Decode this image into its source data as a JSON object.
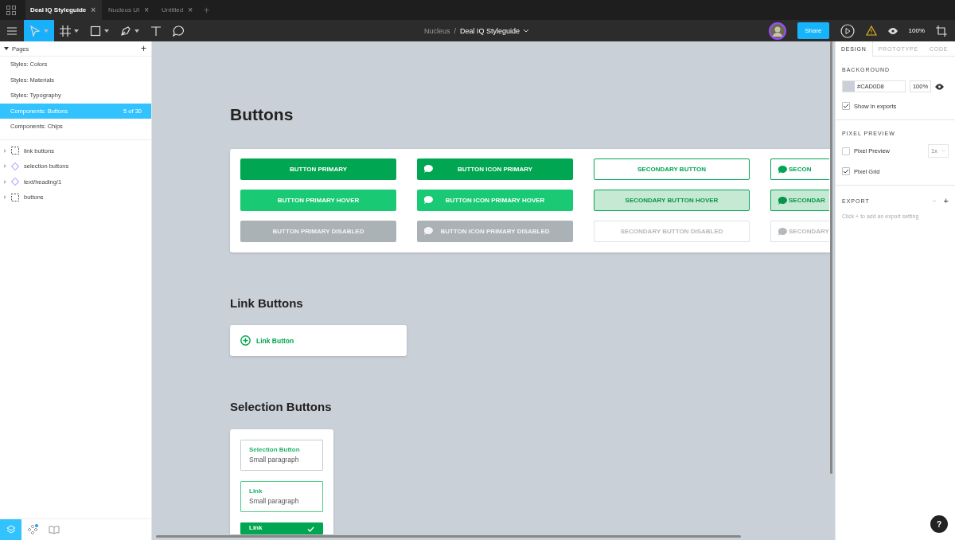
{
  "file_tabs": [
    {
      "label": "Deal IQ Styleguide",
      "selected": true,
      "close": "×"
    },
    {
      "label": "Nucleus UI",
      "selected": false,
      "close": "×"
    },
    {
      "label": "Untitled",
      "selected": false,
      "close": "×"
    }
  ],
  "new_tab": "+",
  "tools": [
    {
      "kind": "select",
      "selected": true,
      "dropdown": true
    },
    {
      "kind": "frame",
      "selected": false,
      "dropdown": true
    },
    {
      "kind": "shape",
      "selected": false,
      "dropdown": true
    },
    {
      "kind": "pen",
      "selected": false,
      "dropdown": true
    },
    {
      "kind": "text",
      "selected": false,
      "dropdown": false
    },
    {
      "kind": "comment",
      "selected": false,
      "dropdown": false
    }
  ],
  "breadcrumb": {
    "project": "Nucleus",
    "separator": "/",
    "file": "Deal IQ Styleguide"
  },
  "share": "Share",
  "zoom": "100%",
  "pages": {
    "title": "Pages",
    "add": "+",
    "expanded": true,
    "items": [
      {
        "label": "Styles: Colors",
        "selected": false
      },
      {
        "label": "Styles: Materials",
        "selected": false
      },
      {
        "label": "Styles: Typography",
        "selected": false
      },
      {
        "label": "Components: Buttons",
        "selected": true,
        "count": "5 of 30"
      },
      {
        "label": "Components: Chips",
        "selected": false
      }
    ]
  },
  "layers": [
    {
      "kind": "frame",
      "label": "link buttons"
    },
    {
      "kind": "component",
      "label": "selection buttons"
    },
    {
      "kind": "component",
      "label": "text/heading/1"
    },
    {
      "kind": "frame",
      "label": "buttons"
    }
  ],
  "bottom_tabs": [
    {
      "kind": "layers",
      "selected": true,
      "badge": false
    },
    {
      "kind": "components",
      "selected": false,
      "badge": true
    },
    {
      "kind": "library",
      "selected": false,
      "badge": false
    }
  ],
  "canvas": {
    "headings": [
      "Buttons",
      "Link Buttons",
      "Selection Buttons"
    ],
    "button_grid": [
      [
        {
          "label": "BUTTON PRIMARY",
          "kind": "primary",
          "icon": false
        },
        {
          "label": "BUTTON ICON PRIMARY",
          "kind": "primary",
          "icon": true
        },
        {
          "label": "SECONDARY BUTTON",
          "kind": "secondary",
          "icon": false
        },
        {
          "label": "SECON",
          "kind": "secondary",
          "icon": true
        }
      ],
      [
        {
          "label": "BUTTON PRIMARY HOVER",
          "kind": "primary",
          "hover": true,
          "icon": false
        },
        {
          "label": "BUTTON ICON PRIMARY HOVER",
          "kind": "primary",
          "hover": true,
          "icon": true
        },
        {
          "label": "SECONDARY BUTTON HOVER",
          "kind": "secondary",
          "hover": true,
          "icon": false
        },
        {
          "label": "SECONDAR",
          "kind": "secondary",
          "hover": true,
          "icon": true
        }
      ],
      [
        {
          "label": "BUTTON PRIMARY DISABLED",
          "kind": "primary",
          "disabled": true,
          "icon": false
        },
        {
          "label": "BUTTON ICON PRIMARY DISABLED",
          "kind": "primary",
          "disabled": true,
          "icon": true
        },
        {
          "label": "SECONDARY BUTTON DISABLED",
          "kind": "secondary",
          "disabled": true,
          "icon": false
        },
        {
          "label": "SECONDARY",
          "kind": "secondary",
          "disabled": true,
          "icon": true
        }
      ]
    ],
    "link_button": "Link Button",
    "selection_buttons": [
      {
        "title": "Selection Button",
        "text": "Small paragraph",
        "hover": false,
        "selected": false
      },
      {
        "title": "Link",
        "text": "Small paragraph",
        "hover": true,
        "selected": false
      },
      {
        "title": "Link",
        "hover": false,
        "selected": true
      }
    ]
  },
  "inspector": {
    "tabs": [
      {
        "label": "DESIGN",
        "selected": true
      },
      {
        "label": "PROTOTYPE",
        "selected": false
      },
      {
        "label": "CODE",
        "selected": false
      }
    ],
    "background": {
      "title": "BACKGROUND",
      "color": "#cad0d8",
      "hex": "#CAD0D8",
      "opacity": "100%",
      "visible": true,
      "show_in_exports": {
        "label": "Show in exports",
        "checked": true
      }
    },
    "pixel_preview": {
      "title": "PIXEL PREVIEW",
      "options": [
        {
          "label": "Pixel Preview",
          "checked": false,
          "scale": "1x"
        },
        {
          "label": "Pixel Grid",
          "checked": true
        }
      ]
    },
    "export": {
      "title": "EXPORT",
      "remove": "−",
      "add": "+",
      "hint": "Click + to add an export setting"
    }
  },
  "help": "?"
}
